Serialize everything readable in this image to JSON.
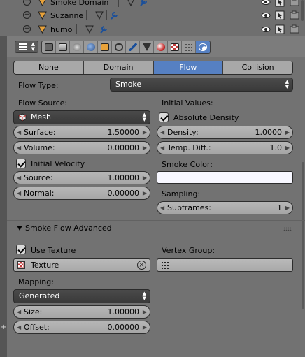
{
  "outliner": {
    "rows": [
      {
        "name": "Smoke Domain"
      },
      {
        "name": "Suzanne"
      },
      {
        "name": "humo"
      }
    ]
  },
  "header": {
    "context_tabs": [
      "render-icon",
      "render-layers-icon",
      "scene-icon",
      "world-icon",
      "object-icon",
      "constraints-icon",
      "modifiers-icon",
      "data-icon",
      "material-icon",
      "texture-icon",
      "particles-icon",
      "physics-icon"
    ],
    "active_tab": "physics-icon"
  },
  "tabs": [
    {
      "label": "None",
      "active": false
    },
    {
      "label": "Domain",
      "active": false
    },
    {
      "label": "Flow",
      "active": true
    },
    {
      "label": "Collision",
      "active": false
    }
  ],
  "flow": {
    "flow_type_label": "Flow Type:",
    "flow_type_value": "Smoke",
    "flow_source_label": "Flow Source:",
    "flow_source_value": "Mesh",
    "surface_label": "Surface:",
    "surface_value": "1.50000",
    "volume_label": "Volume:",
    "volume_value": "0.00000",
    "initial_velocity_label": "Initial Velocity",
    "source_label": "Source:",
    "source_value": "1.00000",
    "normal_label": "Normal:",
    "normal_value": "0.00000",
    "initial_values_label": "Initial Values:",
    "absolute_density_label": "Absolute Density",
    "density_label": "Density:",
    "density_value": "1.0000",
    "temp_diff_label": "Temp. Diff.:",
    "temp_diff_value": "1.0",
    "smoke_color_label": "Smoke Color:",
    "smoke_color": "#f7f7ff",
    "sampling_label": "Sampling:",
    "subframes_label": "Subframes:",
    "subframes_value": "1"
  },
  "advanced": {
    "title": "Smoke Flow Advanced",
    "use_texture_label": "Use Texture",
    "texture_value": "Texture",
    "vertex_group_label": "Vertex Group:",
    "mapping_label": "Mapping:",
    "mapping_value": "Generated",
    "size_label": "Size:",
    "size_value": "1.00000",
    "offset_label": "Offset:",
    "offset_value": "0.00000"
  },
  "colors": {
    "accent": "#5680c2",
    "panel_bg": "#727272",
    "cone_icon": "#e8a23a"
  }
}
